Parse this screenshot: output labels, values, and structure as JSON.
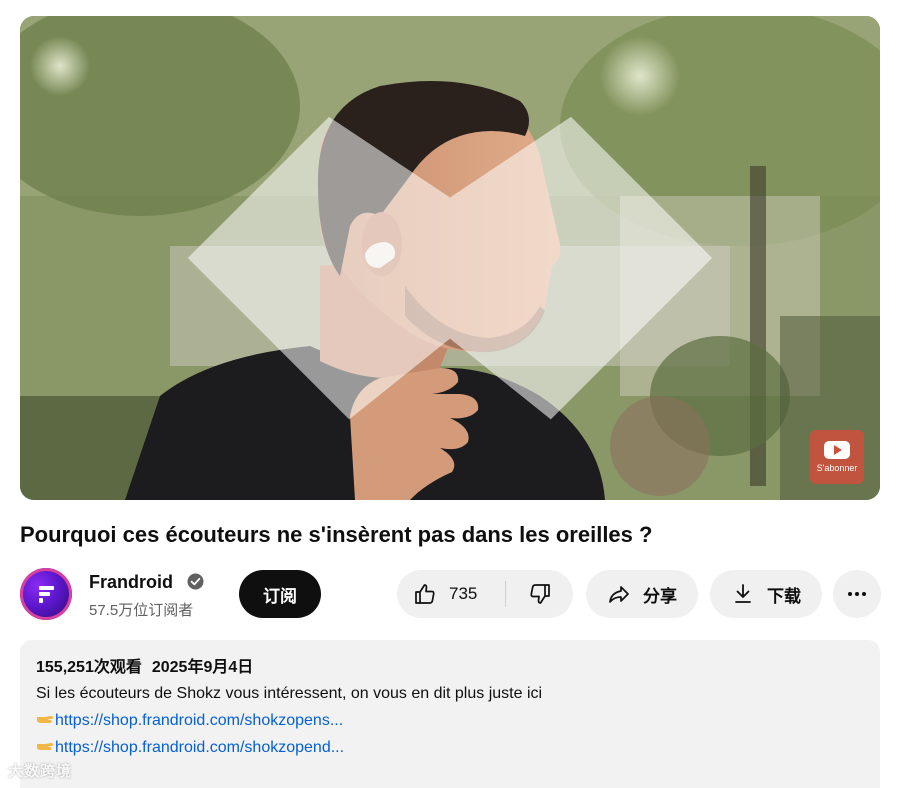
{
  "video": {
    "title": "Pourquoi ces écouteurs ne s'insèrent pas dans les oreilles ?",
    "watermark_label": "S'abonner"
  },
  "channel": {
    "name": "Frandroid",
    "subscribers": "57.5万位订阅者",
    "subscribe_label": "订阅",
    "verified_icon": "check-circle-icon"
  },
  "actions": {
    "likes": "735",
    "share_label": "分享",
    "download_label": "下载",
    "like_icon": "thumbs-up-icon",
    "dislike_icon": "thumbs-down-icon",
    "share_icon": "share-arrow-icon",
    "download_icon": "download-icon",
    "more_icon": "more-horizontal-icon"
  },
  "description": {
    "views": "155,251次观看",
    "date": "2025年9月4日",
    "text": "Si les écouteurs de Shokz vous intéressent, on vous en dit plus juste ici",
    "links": [
      "https://shop.frandroid.com/shokzopens...",
      "https://shop.frandroid.com/shokzopend..."
    ]
  },
  "overlay": {
    "corner_watermark": "大数跨境"
  },
  "colors": {
    "link": "#065fd4",
    "subscribe_bg": "#0f0f0f",
    "pill_bg": "#f0f0f0",
    "description_bg": "#f2f2f2"
  }
}
